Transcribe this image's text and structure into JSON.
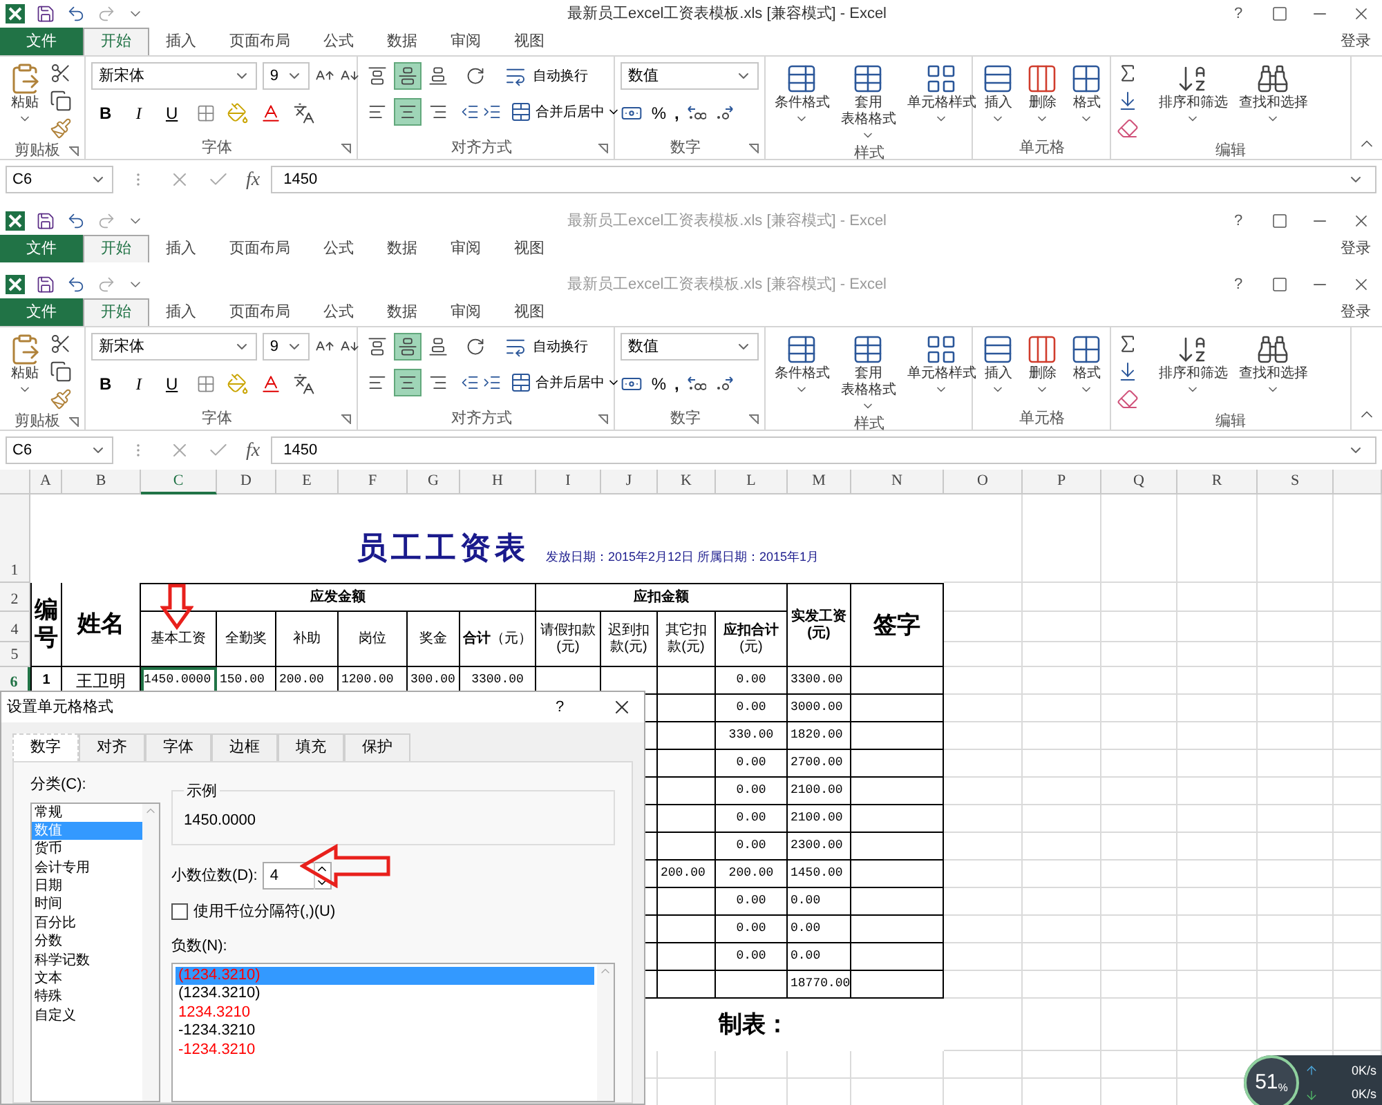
{
  "windows": [
    {
      "title": "最新员工excel工资表模板.xls  [兼容模式] - Excel",
      "active": true,
      "help": "?",
      "sign_in": "登录",
      "tabs": [
        {
          "label": "文件",
          "kind": "file",
          "selected": false
        },
        {
          "label": "开始",
          "kind": "tab",
          "selected": true
        },
        {
          "label": "插入",
          "kind": "tab",
          "selected": false
        },
        {
          "label": "页面布局",
          "kind": "tab",
          "selected": false
        },
        {
          "label": "公式",
          "kind": "tab",
          "selected": false
        },
        {
          "label": "数据",
          "kind": "tab",
          "selected": false
        },
        {
          "label": "审阅",
          "kind": "tab",
          "selected": false
        },
        {
          "label": "视图",
          "kind": "tab",
          "selected": false
        }
      ],
      "ribbon": {
        "paste": "粘贴",
        "font_name": "新宋体",
        "font_size": "9",
        "bold": "B",
        "italic": "I",
        "underline": "U",
        "vertical": [
          {
            "kind": "top",
            "on": false
          },
          {
            "kind": "middle",
            "on": true
          },
          {
            "kind": "bottom",
            "on": false
          }
        ],
        "horizontal": [
          {
            "kind": "left",
            "on": false
          },
          {
            "kind": "center",
            "on": true
          },
          {
            "kind": "right",
            "on": false
          }
        ],
        "wrap": "自动换行",
        "merge": "合并后居中",
        "number_format": "数值",
        "percent": "%",
        "comma": ",",
        "styles": [
          {
            "kind": "conditional",
            "lines": [
              "条件格式"
            ]
          },
          {
            "kind": "table",
            "lines": [
              "套用",
              "表格格式"
            ]
          },
          {
            "kind": "cellstyle",
            "lines": [
              "单元格样式"
            ]
          }
        ],
        "cells": [
          {
            "kind": "insert",
            "lines": [
              "插入"
            ]
          },
          {
            "kind": "delete",
            "lines": [
              "删除"
            ]
          },
          {
            "kind": "format",
            "lines": [
              "格式"
            ]
          }
        ],
        "editing": [
          {
            "kind": "sort",
            "lines": [
              "排序和筛选"
            ]
          },
          {
            "kind": "find",
            "lines": [
              "查找和选择"
            ]
          }
        ],
        "group_labels": [
          "剪贴板",
          "字体",
          "对齐方式",
          "数字",
          "样式",
          "单元格",
          "编辑"
        ]
      },
      "formula_bar": {
        "name_box": "C6",
        "fx": "fx",
        "value": "1450"
      }
    },
    {
      "title": "最新员工excel工资表模板.xls  [兼容模式] - Excel",
      "active": false,
      "help": "?",
      "sign_in": "登录",
      "tabs": [
        {
          "label": "文件",
          "kind": "file",
          "selected": false
        },
        {
          "label": "开始",
          "kind": "tab",
          "selected": true
        },
        {
          "label": "插入",
          "kind": "tab",
          "selected": false
        },
        {
          "label": "页面布局",
          "kind": "tab",
          "selected": false
        },
        {
          "label": "公式",
          "kind": "tab",
          "selected": false
        },
        {
          "label": "数据",
          "kind": "tab",
          "selected": false
        },
        {
          "label": "审阅",
          "kind": "tab",
          "selected": false
        },
        {
          "label": "视图",
          "kind": "tab",
          "selected": false
        }
      ]
    },
    {
      "title": "最新员工excel工资表模板.xls  [兼容模式] - Excel",
      "active": false,
      "help": "?",
      "sign_in": "登录",
      "tabs": [
        {
          "label": "文件",
          "kind": "file",
          "selected": false
        },
        {
          "label": "开始",
          "kind": "tab",
          "selected": true
        },
        {
          "label": "插入",
          "kind": "tab",
          "selected": false
        },
        {
          "label": "页面布局",
          "kind": "tab",
          "selected": false
        },
        {
          "label": "公式",
          "kind": "tab",
          "selected": false
        },
        {
          "label": "数据",
          "kind": "tab",
          "selected": false
        },
        {
          "label": "审阅",
          "kind": "tab",
          "selected": false
        },
        {
          "label": "视图",
          "kind": "tab",
          "selected": false
        }
      ],
      "ribbon": {
        "paste": "粘贴",
        "font_name": "新宋体",
        "font_size": "9",
        "bold": "B",
        "italic": "I",
        "underline": "U",
        "vertical": [
          {
            "kind": "top",
            "on": false
          },
          {
            "kind": "middle",
            "on": true
          },
          {
            "kind": "bottom",
            "on": false
          }
        ],
        "horizontal": [
          {
            "kind": "left",
            "on": false
          },
          {
            "kind": "center",
            "on": true
          },
          {
            "kind": "right",
            "on": false
          }
        ],
        "wrap": "自动换行",
        "merge": "合并后居中",
        "number_format": "数值",
        "percent": "%",
        "comma": ",",
        "styles": [
          {
            "kind": "conditional",
            "lines": [
              "条件格式"
            ]
          },
          {
            "kind": "table",
            "lines": [
              "套用",
              "表格格式"
            ]
          },
          {
            "kind": "cellstyle",
            "lines": [
              "单元格样式"
            ]
          }
        ],
        "cells": [
          {
            "kind": "insert",
            "lines": [
              "插入"
            ]
          },
          {
            "kind": "delete",
            "lines": [
              "删除"
            ]
          },
          {
            "kind": "format",
            "lines": [
              "格式"
            ]
          }
        ],
        "editing": [
          {
            "kind": "sort",
            "lines": [
              "排序和筛选"
            ]
          },
          {
            "kind": "find",
            "lines": [
              "查找和选择"
            ]
          }
        ],
        "group_labels": [
          "剪贴板",
          "字体",
          "对齐方式",
          "数字",
          "样式",
          "单元格",
          "编辑"
        ]
      },
      "formula_bar": {
        "name_box": "C6",
        "fx": "fx",
        "value": "1450"
      }
    }
  ],
  "sheet": {
    "columns": [
      {
        "label": "A",
        "selected": false
      },
      {
        "label": "B",
        "selected": false
      },
      {
        "label": "C",
        "selected": true
      },
      {
        "label": "D",
        "selected": false
      },
      {
        "label": "E",
        "selected": false
      },
      {
        "label": "F",
        "selected": false
      },
      {
        "label": "G",
        "selected": false
      },
      {
        "label": "H",
        "selected": false
      },
      {
        "label": "I",
        "selected": false
      },
      {
        "label": "J",
        "selected": false
      },
      {
        "label": "K",
        "selected": false
      },
      {
        "label": "L",
        "selected": false
      },
      {
        "label": "M",
        "selected": false
      },
      {
        "label": "N",
        "selected": false
      },
      {
        "label": "O",
        "selected": false
      },
      {
        "label": "P",
        "selected": false
      },
      {
        "label": "Q",
        "selected": false
      },
      {
        "label": "R",
        "selected": false
      },
      {
        "label": "S",
        "selected": false
      }
    ],
    "rows": [
      {
        "label": "1",
        "selected": false
      },
      {
        "label": "2",
        "selected": false
      },
      {
        "label": "4",
        "selected": false
      },
      {
        "label": "5",
        "selected": false
      },
      {
        "label": "6",
        "selected": true
      }
    ],
    "title": "员工工资表",
    "dates": "发放日期：2015年2月12日  所属日期：2015年1月",
    "header": {
      "no": "编号",
      "name": "姓名",
      "earn_group": "应发金额",
      "earn_cols": [
        "基本工资",
        "全勤奖",
        "补助",
        "岗位",
        "奖金",
        "**合计**（元）"
      ],
      "deduct_group": "应扣金额",
      "deduct_cols": [
        "请假扣款(元)",
        "迟到扣款(元)",
        "其它扣款(元)",
        "**应扣合计**(元)"
      ],
      "net": "实发工资(元)",
      "sign": "签字"
    },
    "first_row": {
      "no": "1",
      "name": "王卫明",
      "earn_values": [
        "1450.0000",
        "150.00",
        "200.00",
        "1200.00",
        "300.00",
        "3300.00"
      ],
      "deduct_total": "0.00",
      "net": "3300.00"
    },
    "more_rows": [
      {
        "deduct_total": "0.00",
        "net": "3000.00"
      },
      {
        "deduct_total": "330.00",
        "net": "1820.00"
      },
      {
        "deduct_total": "0.00",
        "net": "2700.00"
      },
      {
        "deduct_total": "0.00",
        "net": "2100.00"
      },
      {
        "deduct_total": "0.00",
        "net": "2100.00"
      },
      {
        "deduct_total": "0.00",
        "net": "2300.00"
      },
      {
        "other_deduct": "200.00",
        "deduct_total": "200.00",
        "net": "1450.00"
      },
      {
        "deduct_total": "0.00",
        "net": "0.00"
      },
      {
        "deduct_total": "0.00",
        "net": "0.00"
      },
      {
        "deduct_total": "0.00",
        "net": "0.00"
      },
      {
        "net": "18770.00"
      }
    ],
    "prepared_by": "制表："
  },
  "dialog": {
    "title": "设置单元格格式",
    "help": "?",
    "tabs": [
      {
        "label": "数字",
        "selected": true
      },
      {
        "label": "对齐",
        "selected": false
      },
      {
        "label": "字体",
        "selected": false
      },
      {
        "label": "边框",
        "selected": false
      },
      {
        "label": "填充",
        "selected": false
      },
      {
        "label": "保护",
        "selected": false
      }
    ],
    "category_label": "分类(C):",
    "categories": [
      {
        "label": "常规",
        "selected": false
      },
      {
        "label": "数值",
        "selected": true
      },
      {
        "label": "货币",
        "selected": false
      },
      {
        "label": "会计专用",
        "selected": false
      },
      {
        "label": "日期",
        "selected": false
      },
      {
        "label": "时间",
        "selected": false
      },
      {
        "label": "百分比",
        "selected": false
      },
      {
        "label": "分数",
        "selected": false
      },
      {
        "label": "科学记数",
        "selected": false
      },
      {
        "label": "文本",
        "selected": false
      },
      {
        "label": "特殊",
        "selected": false
      },
      {
        "label": "自定义",
        "selected": false
      }
    ],
    "sample_label": "示例",
    "sample": "1450.0000",
    "decimal_label": "小数位数(D):",
    "decimal_value": "4",
    "thousands": {
      "label": "使用千位分隔符(,)(U)",
      "checked": false
    },
    "negative_label": "负数(N):",
    "negatives": [
      {
        "label": "(1234.3210)",
        "color": "#ff0000",
        "selected": true
      },
      {
        "label": "(1234.3210)",
        "color": "#000000",
        "selected": false
      },
      {
        "label": "1234.3210",
        "color": "#ff0000",
        "selected": false
      },
      {
        "label": "-1234.3210",
        "color": "#000000",
        "selected": false
      },
      {
        "label": "-1234.3210",
        "color": "#ff0000",
        "selected": false
      }
    ]
  },
  "net_widget": {
    "percent": "51",
    "percent_sign": "%",
    "upload": "0K/s",
    "download": "0K/s"
  }
}
